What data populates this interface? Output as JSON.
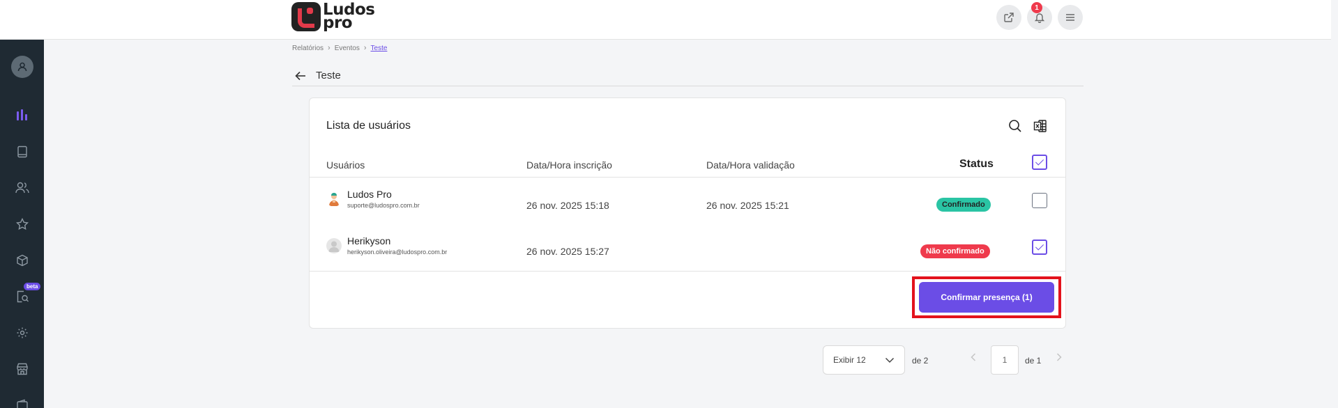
{
  "header": {
    "logo_text_line1": "Ludos",
    "logo_text_line2": "pro",
    "notification_count": "1"
  },
  "sidebar": {
    "beta_label": "beta",
    "items": [
      {
        "icon": "user-avatar-icon"
      },
      {
        "icon": "bar-chart-icon",
        "active": true
      },
      {
        "icon": "book-icon"
      },
      {
        "icon": "users-icon"
      },
      {
        "icon": "star-icon"
      },
      {
        "icon": "box-icon"
      },
      {
        "icon": "search-document-icon"
      },
      {
        "icon": "gear-icon"
      },
      {
        "icon": "store-icon"
      },
      {
        "icon": "wallet-icon"
      }
    ]
  },
  "breadcrumb": {
    "items": [
      "Relatórios",
      "Eventos",
      "Teste"
    ]
  },
  "page": {
    "title": "Teste"
  },
  "card": {
    "title": "Lista de usuários",
    "columns": [
      "Usuários",
      "Data/Hora inscrição",
      "Data/Hora validação",
      "Status"
    ],
    "rows": [
      {
        "name": "Ludos Pro",
        "email": "suporte@ludospro.com.br",
        "registered": "26 nov. 2025 15:18",
        "validated": "26 nov. 2025 15:21",
        "status": "Confirmado",
        "checked": false
      },
      {
        "name": "Herikyson",
        "email": "herikyson.oliveira@ludospro.com.br",
        "registered": "26 nov. 2025 15:27",
        "validated": "",
        "status": "Não confirmado",
        "checked": true
      }
    ],
    "confirm_button": "Confirmar presença (1)"
  },
  "pagination": {
    "per_page": "Exibir 12",
    "total_items": "de 2",
    "current_page": "1",
    "total_pages": "de 1"
  },
  "colors": {
    "accent": "#6b4de6",
    "sidebar_bg": "#1f2a33",
    "confirmed": "#2ac4a4",
    "not_confirmed": "#ef3a4c",
    "highlight": "#e3121c"
  }
}
